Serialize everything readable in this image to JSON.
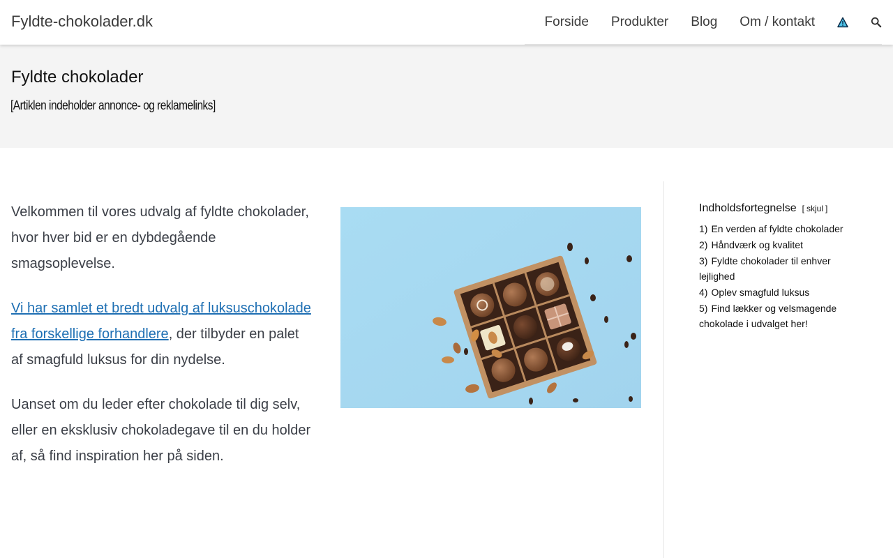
{
  "header": {
    "site_title": "Fyldte-chokolader.dk",
    "nav": [
      {
        "label": "Forside"
      },
      {
        "label": "Produkter"
      },
      {
        "label": "Blog"
      },
      {
        "label": "Om / kontakt"
      }
    ],
    "icons": [
      "warning-triangle-icon",
      "search-icon"
    ]
  },
  "title_band": {
    "title": "Fyldte chokolader",
    "disclaimer": "[Artiklen indeholder annonce- og reklamelinks]"
  },
  "content": {
    "intro": "Velkommen til vores udvalg af fyldte chokolader, hvor hver bid er en dybdegående smagsoplevelse.",
    "link_text": "Vi har samlet et bredt udvalg af luksuschokolade fra forskellige forhandlere",
    "link_tail": ", der tilbyder en palet af smagfuld luksus for din nydelse.",
    "paragraph3": "Uanset om du leder efter chokolade til dig selv, eller en eksklusiv chokoladegave til en du holder af, så find inspiration her på siden."
  },
  "toc": {
    "title": "Indholdsfortegnelse",
    "toggle_open": "[",
    "toggle_label": "skjul",
    "toggle_close": "]",
    "items": [
      {
        "num": "1)",
        "label": "En verden af fyldte chokolader"
      },
      {
        "num": "2)",
        "label": "Håndværk og kvalitet"
      },
      {
        "num": "3)",
        "label": "Fyldte chokolader til enhver lejlighed"
      },
      {
        "num": "4)",
        "label": "Oplev smagfuld luksus"
      },
      {
        "num": "5)",
        "label": "Find lækker og velsmagende chokolade i udvalget her!"
      }
    ]
  },
  "colors": {
    "link": "#1e6fb3",
    "band": "#f4f4f4",
    "image_background": "#a6d8f0"
  }
}
